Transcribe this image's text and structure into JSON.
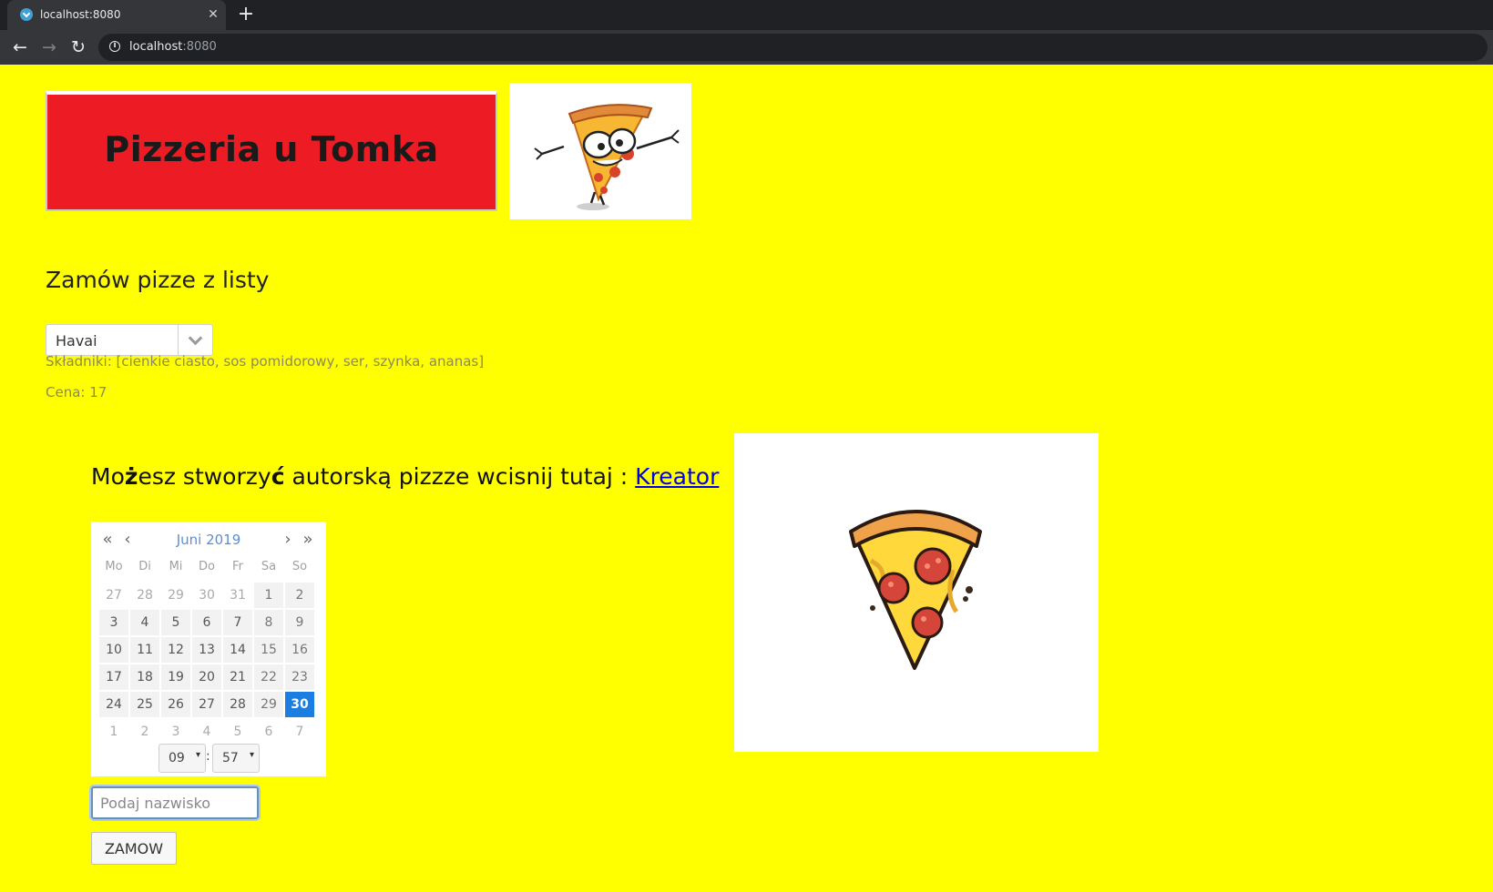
{
  "browser": {
    "tab_title": "localhost:8080",
    "tab_close": "✕",
    "new_tab": "+",
    "back": "←",
    "forward": "→",
    "reload": "↻",
    "info": "i",
    "url_host": "localhost",
    "url_port": ":8080"
  },
  "header": {
    "banner_title": "Pizzeria u Tomka"
  },
  "order": {
    "heading": "Zamów pizze z listy",
    "selected_pizza": "Havai",
    "ingredients": "Składniki: [cienkie ciasto, sos pomidorowy, ser, szynka, ananas]",
    "price": "Cena: 17"
  },
  "creator": {
    "prefix_1": "Mo",
    "bold_1": "ż",
    "prefix_2": "esz stworzy",
    "bold_2": "ć",
    "rest": " autorską pizzze wcisnij tutaj : ",
    "link": "Kreator"
  },
  "calendar": {
    "month_label": "Juni 2019",
    "nav_prev_year": "«",
    "nav_prev": "‹",
    "nav_next": "›",
    "nav_next_year": "»",
    "weekdays": [
      "Mo",
      "Di",
      "Mi",
      "Do",
      "Fr",
      "Sa",
      "So"
    ],
    "days": [
      [
        "27",
        "28",
        "29",
        "30",
        "31",
        "1",
        "2"
      ],
      [
        "3",
        "4",
        "5",
        "6",
        "7",
        "8",
        "9"
      ],
      [
        "10",
        "11",
        "12",
        "13",
        "14",
        "15",
        "16"
      ],
      [
        "17",
        "18",
        "19",
        "20",
        "21",
        "22",
        "23"
      ],
      [
        "24",
        "25",
        "26",
        "27",
        "28",
        "29",
        "30"
      ],
      [
        "1",
        "2",
        "3",
        "4",
        "5",
        "6",
        "7"
      ]
    ],
    "selected_day": "30",
    "hour": "09",
    "minute": "57",
    "time_separator": ":",
    "caret": "▾"
  },
  "form": {
    "name_placeholder": "Podaj nazwisko",
    "name_value": "",
    "submit_label": "ZAMOW"
  },
  "colors": {
    "page_background": "#ffff00",
    "banner_red": "#ed1c24",
    "selected_day": "#1c7ee0",
    "link": "#0000ee"
  }
}
